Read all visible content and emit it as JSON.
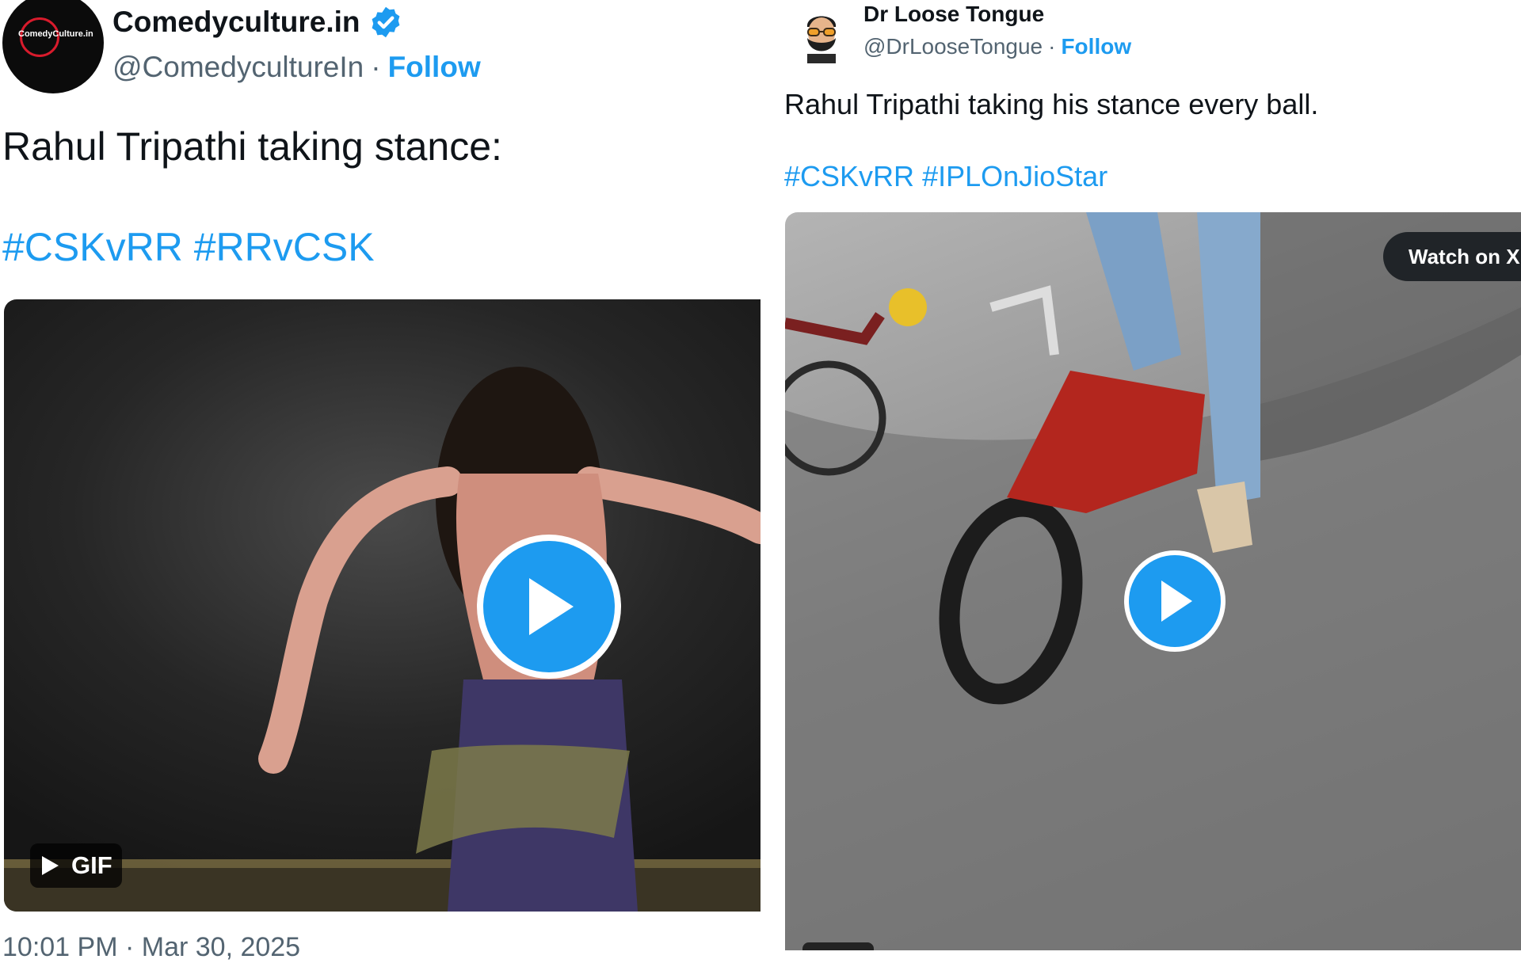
{
  "tweet1": {
    "display_name": "Comedyculture.in",
    "avatar_text": "ComedyCulture.in",
    "verified_icon": "verified-badge-icon",
    "handle": "@ComedycultureIn",
    "separator": "·",
    "follow_label": "Follow",
    "text": "Rahul Tripathi taking stance:",
    "hashtags": [
      "#CSKvRR",
      "#RRvCSK"
    ],
    "media_badge": "GIF",
    "media_badge_icon": "play-small-icon",
    "play_icon": "play-button-icon",
    "timestamp": "10:01 PM · Mar 30, 2025"
  },
  "tweet2": {
    "display_name": "Dr Loose Tongue",
    "avatar_icon": "bearded-man-avatar-icon",
    "handle": "@DrLooseTongue",
    "separator": "·",
    "follow_label": "Follow",
    "text": "Rahul Tripathi taking his stance every ball.",
    "hashtags": [
      "#CSKvRR",
      "#IPLOnJioStar"
    ],
    "watch_label": "Watch on X",
    "play_icon": "play-button-icon"
  },
  "colors": {
    "link": "#1d9bf0",
    "secondary_text": "#536471",
    "primary_text": "#0f1419"
  }
}
